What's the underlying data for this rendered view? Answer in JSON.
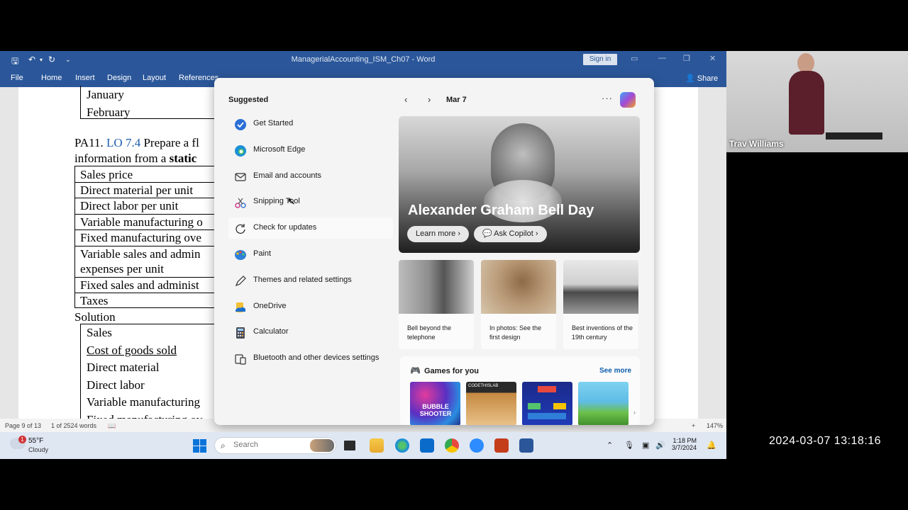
{
  "word": {
    "title": "ManagerialAccounting_ISM_Ch07 - Word",
    "sign_in": "Sign in",
    "share": "Share",
    "tabs": [
      "File",
      "Home",
      "Insert",
      "Design",
      "Layout",
      "References"
    ],
    "status": {
      "page": "Page 9 of 13",
      "words": "1 of 2524 words",
      "zoom": "147%"
    }
  },
  "document": {
    "month_rows": [
      "January",
      "February"
    ],
    "pa11_prefix": "PA11.",
    "pa11_lo": "LO 7.4",
    "pa11_text": "Prepare a fl",
    "pa11_line2_a": "information from a",
    "pa11_line2_b": "static",
    "table1": [
      "Sales price",
      "Direct material per unit",
      "Direct labor per unit",
      "Variable manufacturing o",
      "Fixed manufacturing ove",
      "Variable sales and admin",
      "expenses per unit",
      "Fixed sales and administ",
      "Taxes"
    ],
    "solution": "Solution",
    "table2": [
      "Sales",
      "Cost of goods sold",
      "Direct material",
      "Direct labor",
      "Variable manufacturing",
      "Fixed manufacturing ov"
    ]
  },
  "start_menu": {
    "suggested_heading": "Suggested",
    "items": [
      {
        "label": "Get Started",
        "icon": "get-started-icon"
      },
      {
        "label": "Microsoft Edge",
        "icon": "edge-icon"
      },
      {
        "label": "Email and accounts",
        "icon": "mail-icon"
      },
      {
        "label": "Snipping Tool",
        "icon": "snipping-tool-icon"
      },
      {
        "label": "Check for updates",
        "icon": "refresh-icon"
      },
      {
        "label": "Paint",
        "icon": "paint-icon"
      },
      {
        "label": "Themes and related settings",
        "icon": "pen-icon"
      },
      {
        "label": "OneDrive",
        "icon": "onedrive-icon"
      },
      {
        "label": "Calculator",
        "icon": "calculator-icon"
      },
      {
        "label": "Bluetooth and other devices settings",
        "icon": "bluetooth-devices-icon"
      }
    ],
    "date": "Mar 7",
    "hero": {
      "title": "Alexander Graham Bell Day",
      "learn_more": "Learn more",
      "ask_copilot": "Ask Copilot"
    },
    "cards": [
      "Bell beyond the telephone",
      "In photos: See the first design",
      "Best inventions of the 19th century"
    ],
    "games": {
      "heading": "Games for you",
      "see_more": "See more",
      "tile_1_text": "BUBBLE SHOOTER",
      "tile_2_text": "CODETHISLAB"
    }
  },
  "taskbar": {
    "weather_temp": "55°F",
    "weather_cond": "Cloudy",
    "weather_badge": "1",
    "search_placeholder": "Search",
    "time": "1:18 PM",
    "date": "3/7/2024"
  },
  "webcam": {
    "name": "Trav Williams"
  },
  "recording_timestamp": "2024-03-07  13:18:16"
}
